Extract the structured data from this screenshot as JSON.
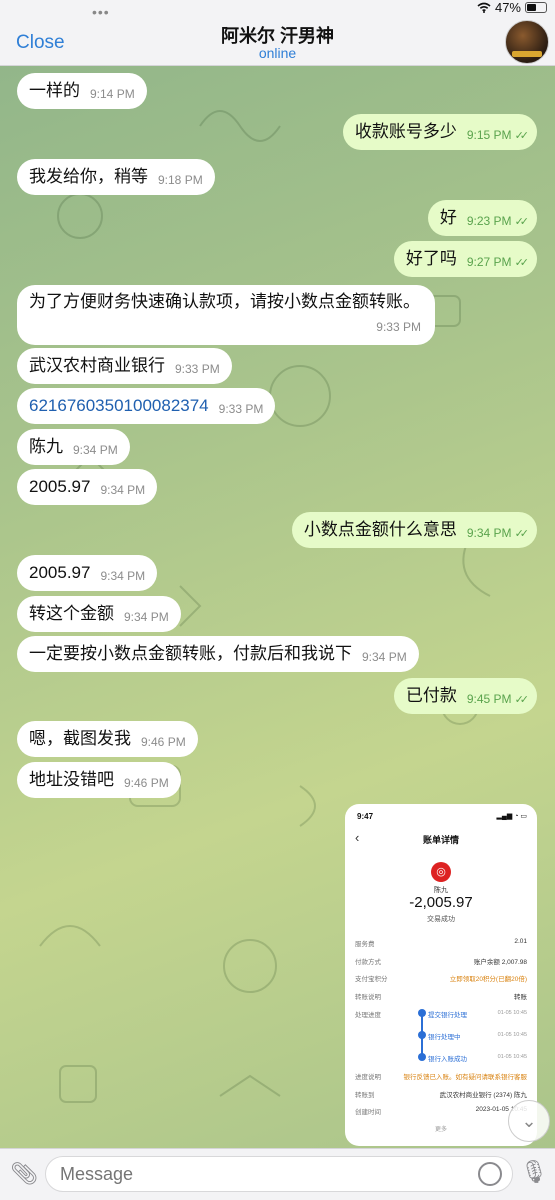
{
  "status_bar": {
    "dots": "•••",
    "battery": "47%"
  },
  "header": {
    "close_label": "Close",
    "title": "阿米尔 汗男神",
    "subtitle": "online",
    "avatar_icon": "avatar-image"
  },
  "messages": [
    {
      "dir": "in",
      "text": "一样的",
      "time": "9:14 PM"
    },
    {
      "dir": "out",
      "text": "收款账号多少",
      "time": "9:15 PM"
    },
    {
      "dir": "in",
      "text": "我发给你，稍等",
      "time": "9:18 PM"
    },
    {
      "dir": "out",
      "text": "好",
      "time": "9:23 PM"
    },
    {
      "dir": "out",
      "text": "好了吗",
      "time": "9:27 PM"
    },
    {
      "dir": "in",
      "text": "为了方便财务快速确认款项，请按小数点金额转账。",
      "time": "9:33 PM"
    },
    {
      "dir": "in",
      "text": "武汉农村商业银行",
      "time": "9:33 PM"
    },
    {
      "dir": "in",
      "text": "6216760350100082374",
      "time": "9:33 PM"
    },
    {
      "dir": "in",
      "text": "陈九",
      "time": "9:34 PM"
    },
    {
      "dir": "in",
      "text": "2005.97",
      "time": "9:34 PM"
    },
    {
      "dir": "out",
      "text": "小数点金额什么意思",
      "time": "9:34 PM"
    },
    {
      "dir": "in",
      "text": "2005.97",
      "time": "9:34 PM"
    },
    {
      "dir": "in",
      "text": "转这个金额",
      "time": "9:34 PM"
    },
    {
      "dir": "in",
      "text": "一定要按小数点金额转账，付款后和我说下",
      "time": "9:34 PM"
    },
    {
      "dir": "out",
      "text": "已付款",
      "time": "9:45 PM"
    },
    {
      "dir": "in",
      "text": "嗯，截图发我",
      "time": "9:46 PM"
    },
    {
      "dir": "in",
      "text": "地址没错吧",
      "time": "9:46 PM"
    }
  ],
  "read_checks": "✓✓",
  "receipt": {
    "time": "9:47",
    "title": "账单详情",
    "payee": "陈九",
    "amount": "-2,005.97",
    "result": "交易成功",
    "rows": [
      {
        "k": "服务费",
        "v": "2.01"
      },
      {
        "k": "付款方式",
        "v": "账户余额 2,007.98"
      },
      {
        "k": "支付宝积分",
        "v": "立即领取20积分(已翻20倍)"
      },
      {
        "k": "转账说明",
        "v": "转账"
      },
      {
        "k": "处理进度",
        "v": ""
      },
      {
        "k": "进度说明",
        "v": "银行反馈已入账。如有疑问请联系银行客服"
      },
      {
        "k": "转账到",
        "v": "武汉农村商业银行 (2374) 陈九"
      },
      {
        "k": "创建时间",
        "v": "2023-01-05 10:45"
      }
    ],
    "steps": [
      {
        "label": "提交银行处理",
        "time": "01-05 10:45"
      },
      {
        "label": "银行处理中",
        "time": "01-05 10:45"
      },
      {
        "label": "银行入账成功",
        "time": "01-05 10:45"
      }
    ],
    "more": "更多"
  },
  "input": {
    "placeholder": "Message"
  },
  "colors": {
    "accent": "#2f7fd6",
    "outgoing_bubble": "#e6fbc8",
    "incoming_bubble": "#ffffff",
    "check": "#5aa34d"
  }
}
